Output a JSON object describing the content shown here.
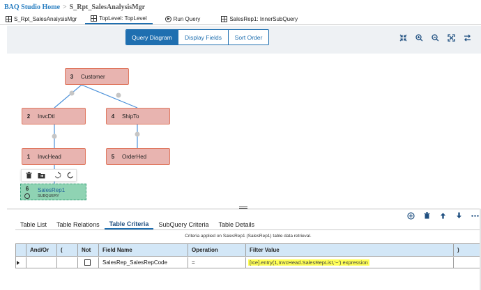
{
  "breadcrumb": {
    "home": "BAQ Studio Home",
    "separator": ">",
    "current": "S_Rpt_SalesAnalysisMgr"
  },
  "tabs": [
    {
      "label": "S_Rpt_SalesAnalysisMgr",
      "icon": "grid-icon",
      "active": false
    },
    {
      "label": "TopLevel: TopLevel",
      "icon": "grid-icon",
      "active": true
    },
    {
      "label": "Run Query",
      "icon": "run-icon",
      "active": false
    },
    {
      "label": "SalesRep1: InnerSubQuery",
      "icon": "grid-icon",
      "active": false
    }
  ],
  "view_toggle": {
    "query_diagram": "Query Diagram",
    "display_fields": "Display Fields",
    "sort_order": "Sort Order",
    "active": "Query Diagram"
  },
  "toolbar_icons": [
    "collapse-icon",
    "zoom-in-icon",
    "zoom-out-icon",
    "fit-screen-icon",
    "swap-icon"
  ],
  "diagram": {
    "nodes": [
      {
        "num": "3",
        "name": "Customer"
      },
      {
        "num": "2",
        "name": "InvcDtl"
      },
      {
        "num": "4",
        "name": "ShipTo"
      },
      {
        "num": "1",
        "name": "InvcHead"
      },
      {
        "num": "5",
        "name": "OrderHed"
      }
    ],
    "subquery": {
      "num": "6",
      "name": "SalesRep1",
      "tag": "SUBQUERY"
    },
    "popup_icons": [
      "trash-icon",
      "folder-move-icon",
      "rotate-left-icon",
      "rotate-right-icon"
    ]
  },
  "bottom_icons": [
    "add-icon",
    "trash-icon",
    "arrow-up-icon",
    "arrow-down-icon",
    "more-icon"
  ],
  "bottom_tabs": [
    {
      "label": "Table List",
      "active": false
    },
    {
      "label": "Table Relations",
      "active": false
    },
    {
      "label": "Table Criteria",
      "active": true
    },
    {
      "label": "SubQuery Criteria",
      "active": false
    },
    {
      "label": "Table Details",
      "active": false
    }
  ],
  "criteria_note": "Criteria applied on SalesRep1 (SalesRep1) table data retrieval.",
  "grid": {
    "headers": [
      "",
      "And/Or",
      "(",
      "Not",
      "Field Name",
      "Operation",
      "Filter Value",
      ")"
    ],
    "row": {
      "and_or": "",
      "open_paren": "",
      "not": false,
      "field_name": "SalesRep_SalesRepCode",
      "operation": "=",
      "filter_value": "[Ice].entry(1,InvcHead.SalesRepList,'~') expression",
      "close_paren": ""
    }
  },
  "colors": {
    "accent": "#1f6fb0",
    "node_fill": "#e8b4b0",
    "node_border": "#e07860",
    "subquery_fill": "#8fd3b3",
    "highlight": "#ffff55",
    "grid_header": "#d3e7f7"
  }
}
